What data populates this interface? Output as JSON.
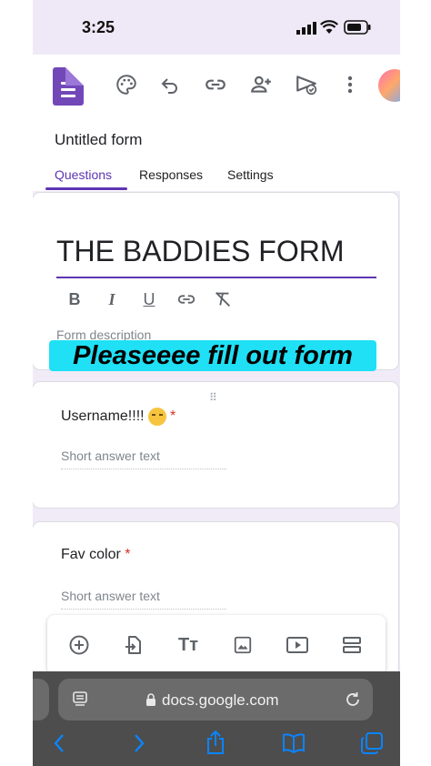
{
  "status_bar": {
    "time": "3:25"
  },
  "form_header": {
    "doc_title": "Untitled form",
    "tabs": [
      {
        "label": "Questions",
        "active": true
      },
      {
        "label": "Responses",
        "active": false
      },
      {
        "label": "Settings",
        "active": false
      }
    ]
  },
  "title_card": {
    "form_title": "THE BADDIES FORM",
    "format_icons": [
      "bold-icon",
      "italic-icon",
      "underline-icon",
      "link-icon",
      "clear-format-icon"
    ],
    "description_placeholder": "Form description"
  },
  "banner_text": "Pleaseeee fill out form",
  "questions": [
    {
      "label": "Username!!!!",
      "required_mark": "*",
      "placeholder": "Short answer text"
    },
    {
      "label": "Fav color",
      "required_mark": "*",
      "placeholder": "Short answer text"
    }
  ],
  "browser": {
    "url": "docs.google.com"
  },
  "colors": {
    "accent": "#5e35b1",
    "banner": "#1fe0f5",
    "safari_blue": "#0a84ff"
  }
}
